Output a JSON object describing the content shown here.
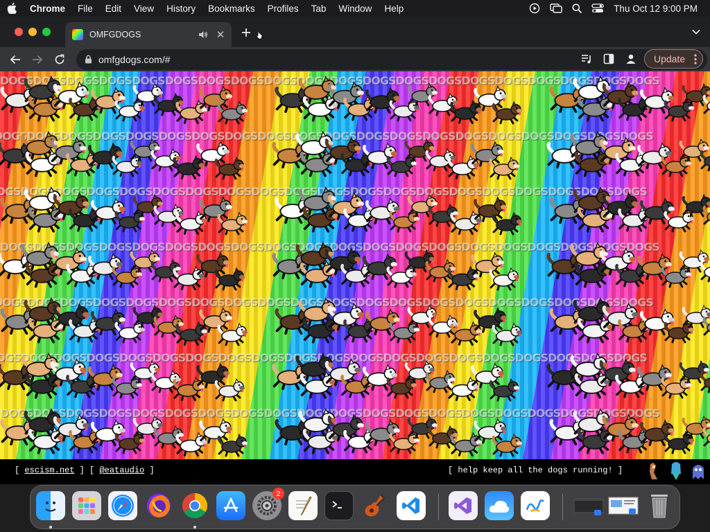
{
  "menubar": {
    "app_name": "Chrome",
    "items": [
      "File",
      "Edit",
      "View",
      "History",
      "Bookmarks",
      "Profiles",
      "Tab",
      "Window",
      "Help"
    ],
    "clock": "Thu Oct 12  9:00 PM"
  },
  "tab": {
    "title": "OMFGDOGS"
  },
  "toolbar": {
    "url": "omfgdogs.com/#",
    "update_label": "Update"
  },
  "page": {
    "background_word": "DOGSDOGSDOGSDOGSDOGSDOGSDOGSDOGSDOGSDOGSDOGSDOGSDOGSDOGSDOGSDOGSDOGSDOGSDOGSDOGS",
    "footer": {
      "open_bracket": "[",
      "link1": "escism.net",
      "separator": "] [",
      "link2": "@eataudio",
      "close_bracket": "]",
      "right_text": "[ help keep all the dogs running! ]"
    }
  },
  "dock": {
    "settings_badge": "2"
  },
  "colors": {
    "menubar_bg": "#1c1c1e",
    "tabstrip_bg": "#202124",
    "toolbar_bg": "#35363a",
    "update_text": "#f2b8b5"
  }
}
